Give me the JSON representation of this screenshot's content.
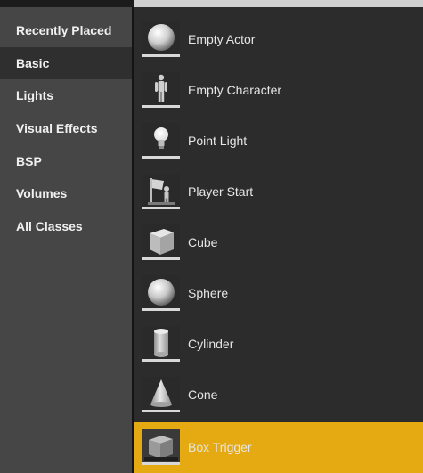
{
  "categories": [
    {
      "label": "Recently Placed"
    },
    {
      "label": "Basic"
    },
    {
      "label": "Lights"
    },
    {
      "label": "Visual Effects"
    },
    {
      "label": "BSP"
    },
    {
      "label": "Volumes"
    },
    {
      "label": "All Classes"
    }
  ],
  "selected_category": "Basic",
  "items": [
    {
      "label": "Empty Actor",
      "icon": "sphere-icon"
    },
    {
      "label": "Empty Character",
      "icon": "character-icon"
    },
    {
      "label": "Point Light",
      "icon": "light-bulb-icon"
    },
    {
      "label": "Player Start",
      "icon": "player-start-icon"
    },
    {
      "label": "Cube",
      "icon": "cube-icon"
    },
    {
      "label": "Sphere",
      "icon": "sphere-icon"
    },
    {
      "label": "Cylinder",
      "icon": "cylinder-icon"
    },
    {
      "label": "Cone",
      "icon": "cone-icon"
    },
    {
      "label": "Box Trigger",
      "icon": "box-trigger-icon"
    }
  ],
  "highlighted_item": "Box Trigger",
  "colors": {
    "highlight": "#e5a912",
    "sidebar": "#464646",
    "content": "#2c2c2c"
  }
}
